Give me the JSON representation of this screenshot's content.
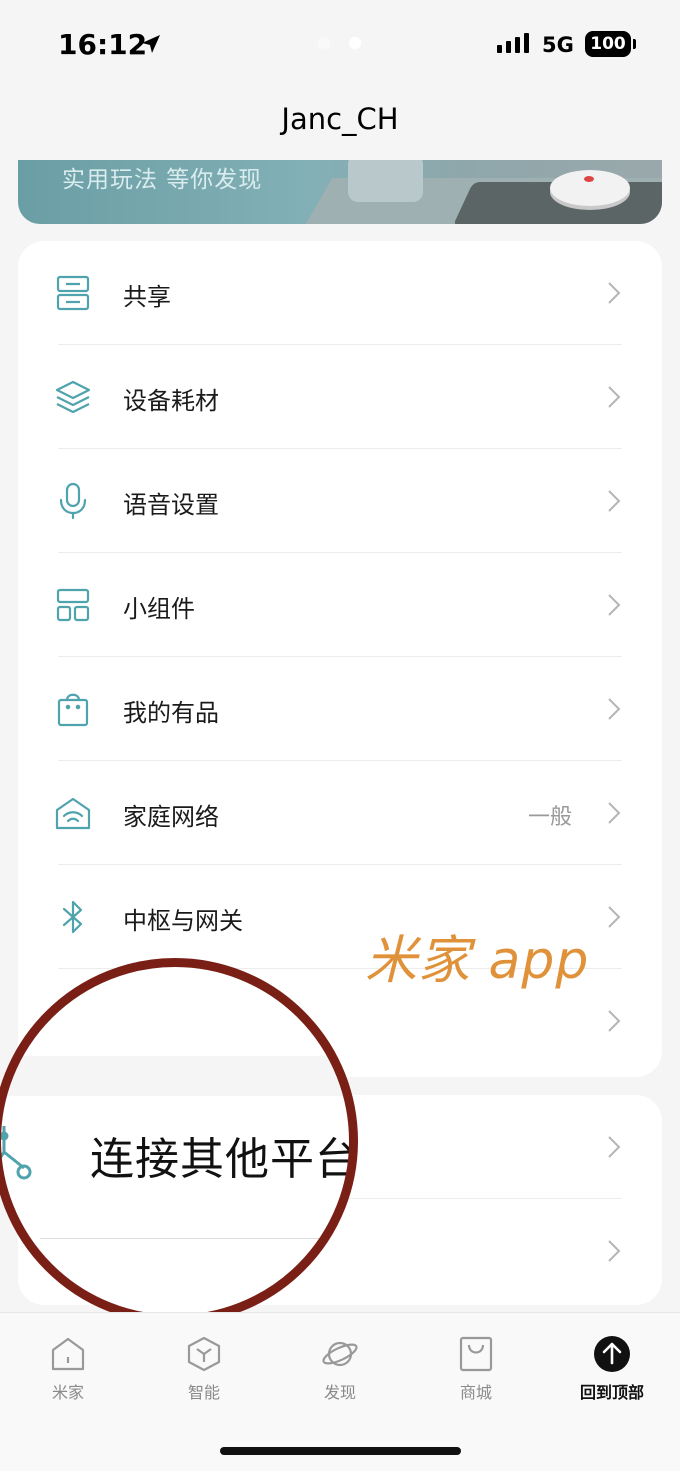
{
  "status_bar": {
    "time": "16:12",
    "network": "5G",
    "battery": "100"
  },
  "page_title": "Janc_CH",
  "banner": {
    "text": "实用玩法 等你发现"
  },
  "settings_list": [
    {
      "label": "共享",
      "icon": "share-icon",
      "value": ""
    },
    {
      "label": "设备耗材",
      "icon": "layers-icon",
      "value": ""
    },
    {
      "label": "语音设置",
      "icon": "microphone-icon",
      "value": ""
    },
    {
      "label": "小组件",
      "icon": "widget-icon",
      "value": ""
    },
    {
      "label": "我的有品",
      "icon": "shopping-bag-icon",
      "value": ""
    },
    {
      "label": "家庭网络",
      "icon": "home-wifi-icon",
      "value": "一般"
    },
    {
      "label": "中枢与网关",
      "icon": "bluetooth-icon",
      "value": ""
    },
    {
      "label": "",
      "icon": "",
      "value": ""
    }
  ],
  "connect_section": {
    "label": "连接其他平台",
    "icon": "connect-platform-icon"
  },
  "watermark": "米家 app",
  "tab_bar": [
    {
      "label": "米家",
      "icon": "home-icon"
    },
    {
      "label": "智能",
      "icon": "smart-cube-icon"
    },
    {
      "label": "发现",
      "icon": "planet-icon"
    },
    {
      "label": "商城",
      "icon": "shop-bag-icon"
    },
    {
      "label": "回到顶部",
      "icon": "arrow-up-circle-icon"
    }
  ],
  "colors": {
    "accent": "#4fa3ad",
    "circle": "#7a1f16",
    "watermark": "#e0923a"
  }
}
